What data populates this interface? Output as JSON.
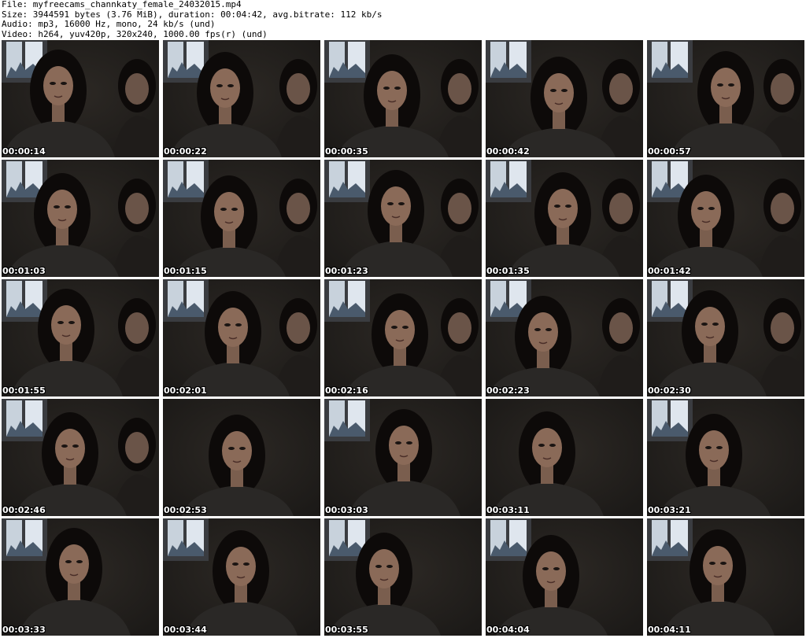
{
  "header": {
    "file_line": "File: myfreecams_channkaty_female_24032015.mp4",
    "size_line": "Size: 3944591 bytes (3.76 MiB), duration: 00:04:42, avg.bitrate: 112 kb/s",
    "audio_line": "Audio: mp3, 16000 Hz, mono, 24 kb/s (und)",
    "video_line": "Video: h264, yuv420p, 320x240, 1000.00 fps(r) (und)"
  },
  "thumbnails": [
    {
      "timestamp": "00:00:14",
      "window": true,
      "second_person": true
    },
    {
      "timestamp": "00:00:22",
      "window": true,
      "second_person": true
    },
    {
      "timestamp": "00:00:35",
      "window": true,
      "second_person": true
    },
    {
      "timestamp": "00:00:42",
      "window": true,
      "second_person": true
    },
    {
      "timestamp": "00:00:57",
      "window": true,
      "second_person": true
    },
    {
      "timestamp": "00:01:03",
      "window": true,
      "second_person": true
    },
    {
      "timestamp": "00:01:15",
      "window": true,
      "second_person": true
    },
    {
      "timestamp": "00:01:23",
      "window": true,
      "second_person": true
    },
    {
      "timestamp": "00:01:35",
      "window": true,
      "second_person": true
    },
    {
      "timestamp": "00:01:42",
      "window": true,
      "second_person": true
    },
    {
      "timestamp": "00:01:55",
      "window": true,
      "second_person": true
    },
    {
      "timestamp": "00:02:01",
      "window": true,
      "second_person": true
    },
    {
      "timestamp": "00:02:16",
      "window": true,
      "second_person": true
    },
    {
      "timestamp": "00:02:23",
      "window": true,
      "second_person": true
    },
    {
      "timestamp": "00:02:30",
      "window": true,
      "second_person": true
    },
    {
      "timestamp": "00:02:46",
      "window": true,
      "second_person": true
    },
    {
      "timestamp": "00:02:53",
      "window": false,
      "second_person": false
    },
    {
      "timestamp": "00:03:03",
      "window": true,
      "second_person": false
    },
    {
      "timestamp": "00:03:11",
      "window": false,
      "second_person": false
    },
    {
      "timestamp": "00:03:21",
      "window": true,
      "second_person": false
    },
    {
      "timestamp": "00:03:33",
      "window": true,
      "second_person": false
    },
    {
      "timestamp": "00:03:44",
      "window": true,
      "second_person": false
    },
    {
      "timestamp": "00:03:55",
      "window": true,
      "second_person": false
    },
    {
      "timestamp": "00:04:04",
      "window": true,
      "second_person": false
    },
    {
      "timestamp": "00:04:11",
      "window": true,
      "second_person": false
    }
  ],
  "colors": {
    "background": "#ffffff",
    "header_text": "#000000",
    "timestamp_text": "#ffffff",
    "room_dark": "#1b1917",
    "window_light": "#c8d2dc",
    "skin": "#8a6a58",
    "hair": "#0d0a09",
    "shirt": "#2a2826"
  }
}
